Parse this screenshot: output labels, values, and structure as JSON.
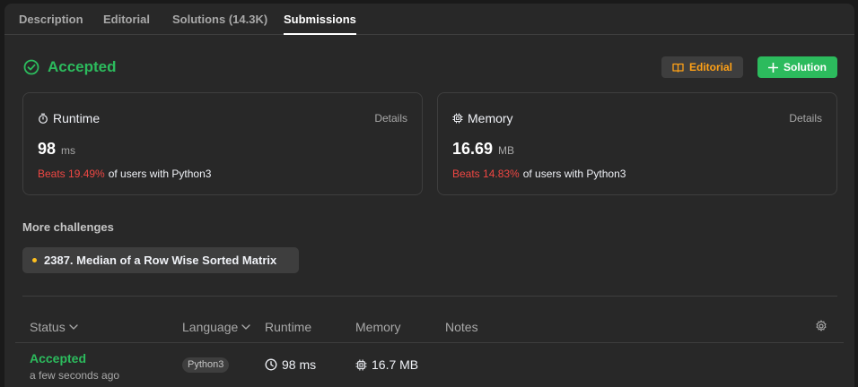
{
  "tabs": [
    {
      "label": "Description"
    },
    {
      "label": "Editorial"
    },
    {
      "label": "Solutions (14.3K)"
    },
    {
      "label": "Submissions"
    }
  ],
  "result": {
    "status": "Accepted",
    "editorial_button": "Editorial",
    "solution_button": "Solution"
  },
  "runtime_card": {
    "title": "Runtime",
    "details": "Details",
    "value": "98",
    "unit": "ms",
    "beats": "Beats 19.49%",
    "beats_suffix": "of users with Python3"
  },
  "memory_card": {
    "title": "Memory",
    "details": "Details",
    "value": "16.69",
    "unit": "MB",
    "beats": "Beats 14.83%",
    "beats_suffix": "of users with Python3"
  },
  "more_challenges": {
    "title": "More challenges",
    "items": [
      {
        "label": "2387. Median of a Row Wise Sorted Matrix"
      }
    ]
  },
  "table": {
    "headers": {
      "status": "Status",
      "language": "Language",
      "runtime": "Runtime",
      "memory": "Memory",
      "notes": "Notes"
    },
    "rows": [
      {
        "status": "Accepted",
        "time": "a few seconds ago",
        "language": "Python3",
        "runtime": "98 ms",
        "memory": "16.7 MB"
      }
    ]
  },
  "colors": {
    "accepted": "#2cbb5d",
    "editorial": "#ffa116",
    "beats": "#ef4743",
    "challenge_dot": "#ffc01e"
  },
  "icons": [
    "check-circle-icon",
    "book-icon",
    "plus-icon",
    "stopwatch-icon",
    "chip-icon",
    "chevron-down-icon",
    "gear-icon",
    "clock-icon"
  ]
}
